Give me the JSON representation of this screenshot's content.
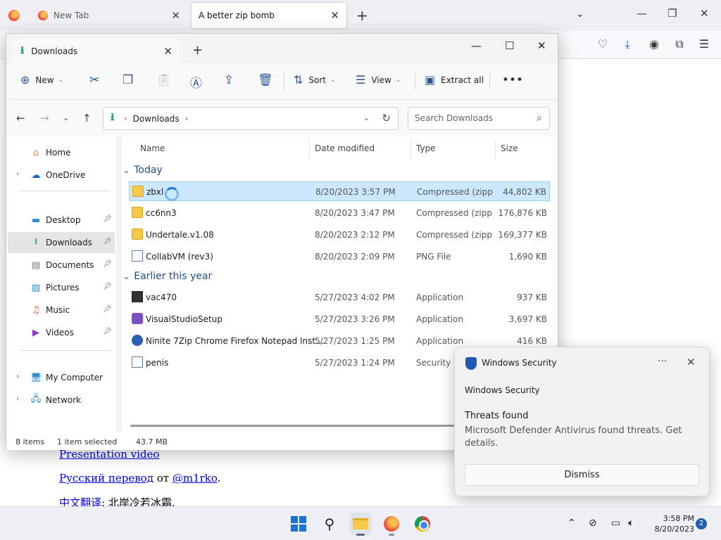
{
  "browser": {
    "tabs": [
      {
        "label": "New Tab"
      },
      {
        "label": "A better zip bomb"
      }
    ],
    "page_links": {
      "presentation": "Presentation video",
      "russian": "Русский перевод",
      "russian_sep": " от ",
      "russian_author": "@m1rko",
      "russian_end": ".",
      "chinese": "中文翻译",
      "chinese_rest": ": 北岸冷若冰霜."
    }
  },
  "explorer": {
    "tab_title": "Downloads",
    "commands": {
      "new": "New",
      "sort": "Sort",
      "view": "View",
      "extract": "Extract all"
    },
    "address": {
      "segment": "Downloads"
    },
    "search_placeholder": "Search Downloads",
    "sidebar": {
      "items": [
        {
          "label": "Home"
        },
        {
          "label": "OneDrive"
        },
        {
          "label": "Desktop"
        },
        {
          "label": "Downloads"
        },
        {
          "label": "Documents"
        },
        {
          "label": "Pictures"
        },
        {
          "label": "Music"
        },
        {
          "label": "Videos"
        },
        {
          "label": "My Computer"
        },
        {
          "label": "Network"
        }
      ]
    },
    "columns": {
      "name": "Name",
      "date": "Date modified",
      "type": "Type",
      "size": "Size"
    },
    "groups": [
      {
        "label": "Today",
        "files": [
          {
            "name": "zbxl",
            "date": "8/20/2023 3:57 PM",
            "type": "Compressed (zipp...",
            "size": "44,802 KB"
          },
          {
            "name": "cc6nn3",
            "date": "8/20/2023 3:47 PM",
            "type": "Compressed (zipp...",
            "size": "176,876 KB"
          },
          {
            "name": "Undertale.v1.08",
            "date": "8/20/2023 2:12 PM",
            "type": "Compressed (zipp...",
            "size": "169,377 KB"
          },
          {
            "name": "CollabVM (rev3)",
            "date": "8/20/2023 2:09 PM",
            "type": "PNG File",
            "size": "1,690 KB"
          }
        ]
      },
      {
        "label": "Earlier this year",
        "files": [
          {
            "name": "vac470",
            "date": "5/27/2023 4:02 PM",
            "type": "Application",
            "size": "937 KB"
          },
          {
            "name": "VisualStudioSetup",
            "date": "5/27/2023 3:26 PM",
            "type": "Application",
            "size": "3,697 KB"
          },
          {
            "name": "Ninite 7Zip Chrome Firefox Notepad Inst...",
            "date": "5/27/2023 1:25 PM",
            "type": "Application",
            "size": "416 KB"
          },
          {
            "name": "penis",
            "date": "5/27/2023 1:24 PM",
            "type": "Security Ca",
            "size": ""
          }
        ]
      }
    ],
    "status": {
      "items": "8 items",
      "selected": "1 item selected",
      "selected_size": "43.7 MB"
    }
  },
  "toast": {
    "app": "Windows Security",
    "source": "Windows Security",
    "title": "Threats found",
    "body": "Microsoft Defender Antivirus found threats. Get details.",
    "dismiss": "Dismiss"
  },
  "taskbar": {
    "time": "3:58 PM",
    "date": "8/20/2023",
    "notifications": "2"
  },
  "colors": {
    "selection": "#cce8ff",
    "accent": "#1f58b5",
    "group_header": "#1f4e8a"
  }
}
